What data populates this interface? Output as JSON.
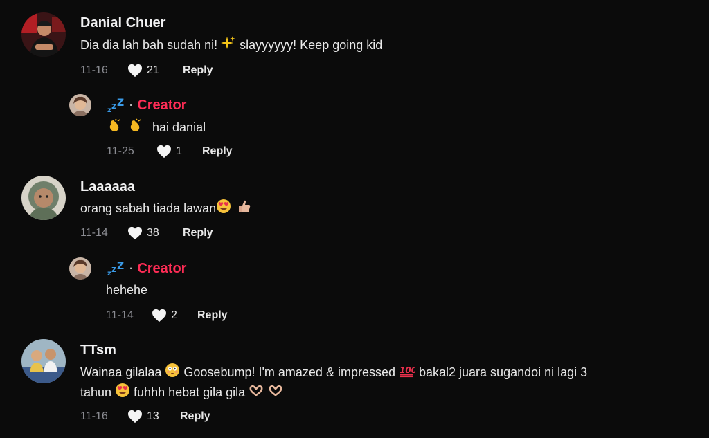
{
  "comments": [
    {
      "author": "Danial Chuer",
      "text_a": "Dia dia lah bah sudah ni! ",
      "text_b": " slayyyyyy! Keep going kid",
      "date": "11-16",
      "likes": "21",
      "reply_label": "Reply",
      "replies": [
        {
          "author_icon": "sleeping-zzz-icon",
          "badge": "Creator",
          "text": "hai danial",
          "date": "11-25",
          "likes": "1",
          "reply_label": "Reply"
        }
      ]
    },
    {
      "author": "Laaaaaa",
      "text_a": "orang sabah tiada lawan",
      "date": "11-14",
      "likes": "38",
      "reply_label": "Reply",
      "replies": [
        {
          "author_icon": "sleeping-zzz-icon",
          "badge": "Creator",
          "text": "hehehe",
          "date": "11-14",
          "likes": "2",
          "reply_label": "Reply"
        }
      ]
    },
    {
      "author": "TTsm",
      "line1_a": "Wainaa gilalaa ",
      "line1_b": " Goosebump! I'm amazed & impressed ",
      "line1_c": " bakal2 juara sugandoi ni lagi 3",
      "line2_a": "tahun ",
      "line2_b": " fuhhh hebat gila gila ",
      "date": "11-16",
      "likes": "13",
      "reply_label": "Reply"
    }
  ],
  "colors": {
    "background": "#0b0b0b",
    "creator_badge": "#fe2c55",
    "muted": "#8a8b91"
  }
}
